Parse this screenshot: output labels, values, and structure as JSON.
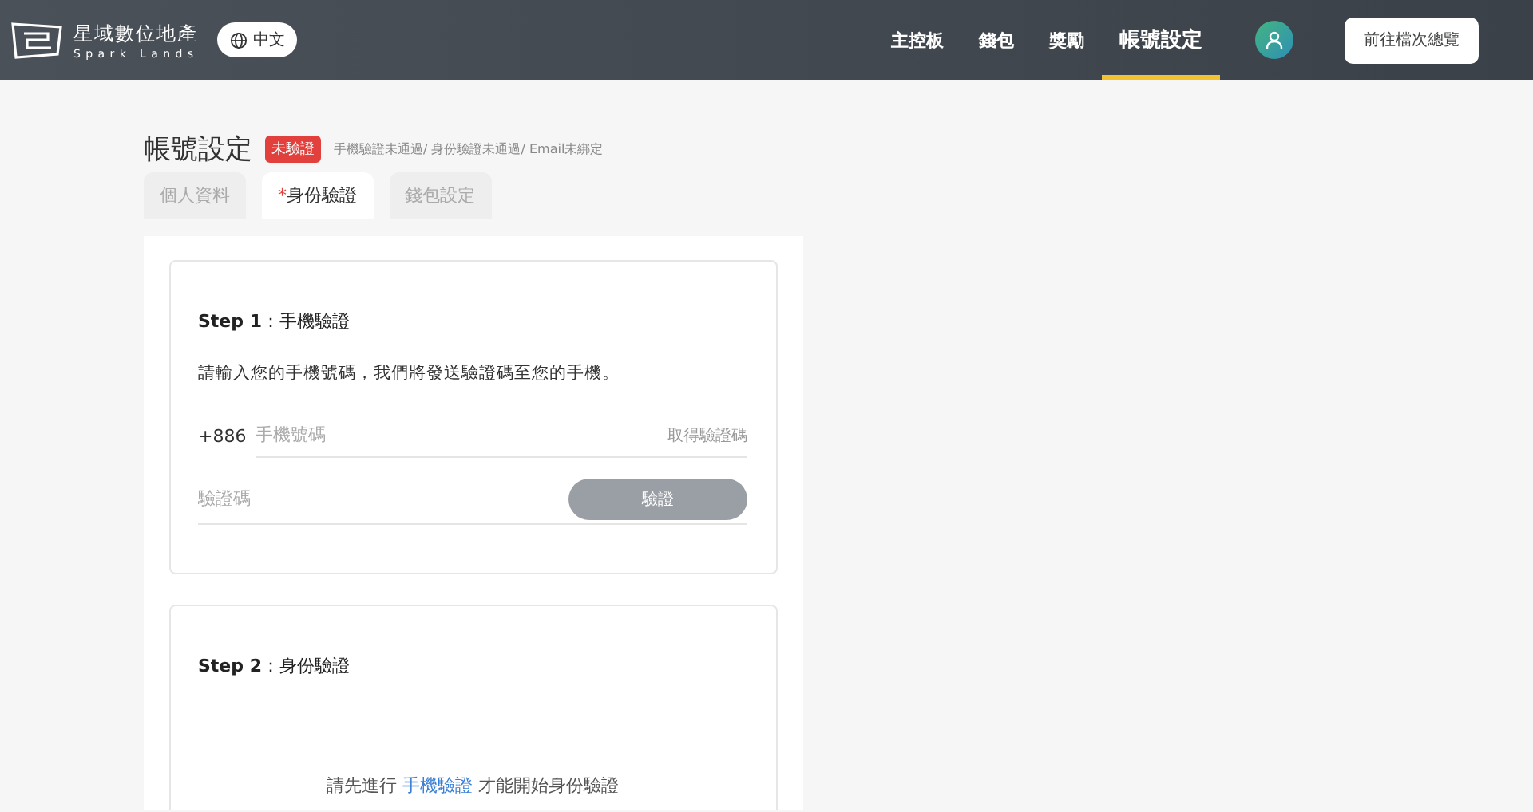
{
  "header": {
    "logo": {
      "name": "星域數位地產",
      "subtitle": "Spark Lands"
    },
    "language": "中文",
    "nav": [
      {
        "label": "主控板",
        "selected": false
      },
      {
        "label": "錢包",
        "selected": false
      },
      {
        "label": "獎勵",
        "selected": false
      },
      {
        "label": "帳號設定",
        "selected": true
      }
    ],
    "cta": "前往檔次總覽"
  },
  "page": {
    "title": "帳號設定",
    "badge": "未驗證",
    "status": "手機驗證未通過/ 身份驗證未通過/ Email未綁定",
    "tabs": [
      {
        "label": "個人資料",
        "selected": false
      },
      {
        "label": "身份驗證",
        "marker": "*",
        "selected": true
      },
      {
        "label": "錢包設定",
        "selected": false
      }
    ]
  },
  "step1": {
    "title": "**Step 1**：手機驗證",
    "instruction": "請輸入您的手機號碼，我們將發送驗證碼至您的手機。",
    "country_code": "+886",
    "phone": {
      "placeholder": "手機號碼"
    },
    "get_code": "取得驗證碼",
    "code": {
      "placeholder": "驗證碼"
    },
    "verify": "驗證",
    "verify_disabled": true
  },
  "step2": {
    "title": "**Step 2**：身份驗證",
    "notice_before": "請先進行 ",
    "notice_link": "手機驗證",
    "notice_after": " 才能開始身份驗證"
  }
}
